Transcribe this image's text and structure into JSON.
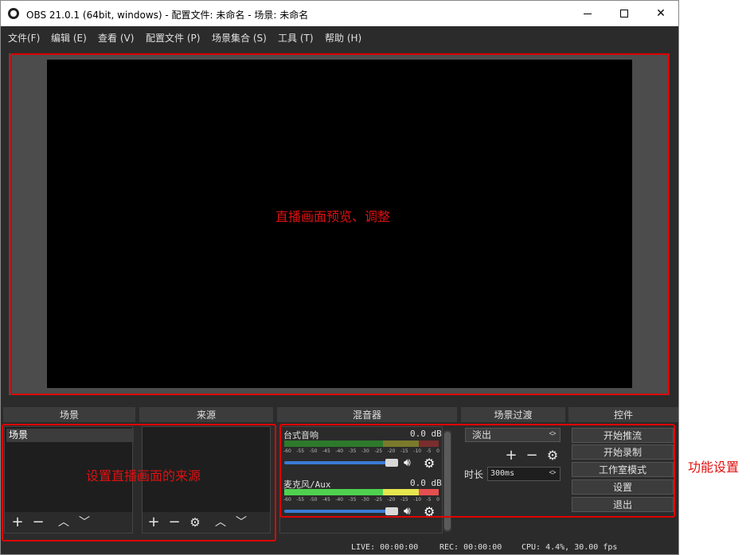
{
  "window": {
    "title": "OBS 21.0.1 (64bit, windows) - 配置文件: 未命名 - 场景: 未命名",
    "controls": {
      "minimize": "—",
      "maximize": "☐",
      "close": "✕"
    }
  },
  "menu": [
    {
      "label": "文件(F)"
    },
    {
      "label": "编辑 (E)"
    },
    {
      "label": "查看 (V)"
    },
    {
      "label": "配置文件 (P)"
    },
    {
      "label": "场景集合 (S)"
    },
    {
      "label": "工具 (T)"
    },
    {
      "label": "帮助 (H)"
    }
  ],
  "annotations": {
    "preview": "直播画面预览、调整",
    "sources": "设置直播画面的来源",
    "controls": "功能设置"
  },
  "docks": {
    "scenes": "场景",
    "sources": "来源",
    "mixer": "混音器",
    "transitions": "场景过渡",
    "controls": "控件"
  },
  "scenes": {
    "items": [
      "场景"
    ]
  },
  "mixer": {
    "channels": [
      {
        "name": "台式音响",
        "db": "0.0 dB",
        "volume_fraction": 0.95,
        "muted": false
      },
      {
        "name": "麦克风/Aux",
        "db": "0.0 dB",
        "volume_fraction": 0.95,
        "muted": false
      }
    ],
    "ticks": [
      "-60",
      "-55",
      "-50",
      "-45",
      "-40",
      "-35",
      "-30",
      "-25",
      "-20",
      "-15",
      "-10",
      "-5",
      "0"
    ]
  },
  "transitions": {
    "selected": "淡出",
    "duration_label": "时长",
    "duration_value": "300ms"
  },
  "controls": {
    "start_stream": "开始推流",
    "start_record": "开始录制",
    "studio_mode": "工作室模式",
    "settings": "设置",
    "exit": "退出"
  },
  "status": {
    "live": "LIVE: 00:00:00",
    "rec": "REC: 00:00:00",
    "cpu": "CPU: 4.4%, 30.00 fps"
  },
  "colors": {
    "annotation": "#e00000",
    "panel_bg": "#2b2b2b",
    "volume_slider": "#3a7bd5"
  }
}
